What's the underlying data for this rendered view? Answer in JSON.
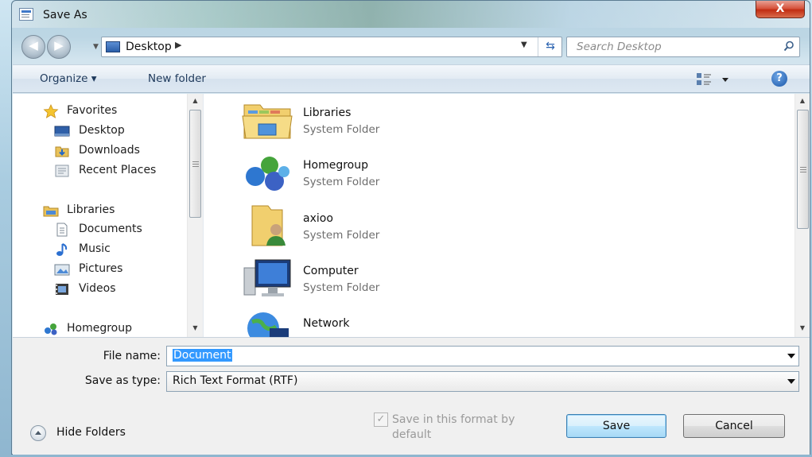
{
  "window": {
    "title": "Save As",
    "close_label": "X"
  },
  "address": {
    "crumb": "Desktop",
    "search_placeholder": "Search Desktop"
  },
  "toolbar": {
    "organize_label": "Organize ▾",
    "new_folder_label": "New folder",
    "help_label": "?"
  },
  "nav": {
    "favorites": "Favorites",
    "desktop": "Desktop",
    "downloads": "Downloads",
    "recent_places": "Recent Places",
    "libraries": "Libraries",
    "documents": "Documents",
    "music": "Music",
    "pictures": "Pictures",
    "videos": "Videos",
    "homegroup": "Homegroup"
  },
  "files": [
    {
      "name": "Libraries",
      "type": "System Folder"
    },
    {
      "name": "Homegroup",
      "type": "System Folder"
    },
    {
      "name": "axioo",
      "type": "System Folder"
    },
    {
      "name": "Computer",
      "type": "System Folder"
    },
    {
      "name": "Network",
      "type": ""
    }
  ],
  "form": {
    "file_name_label": "File name:",
    "file_name_value": "Document",
    "save_type_label": "Save as type:",
    "save_type_value": "Rich Text Format (RTF)",
    "save_format_label": "Save in this format by default",
    "save_format_checked": true,
    "hide_folders_label": "Hide Folders",
    "save_label": "Save",
    "cancel_label": "Cancel"
  }
}
